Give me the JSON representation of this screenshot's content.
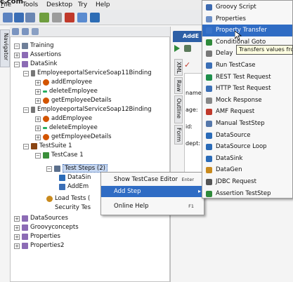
{
  "title_fragment": "c.com",
  "menubar": {
    "tools": "Tools",
    "desktop": "Desktop",
    "try": "Try",
    "help": "Help"
  },
  "navigator_tab": "Navigator",
  "tree": {
    "root": "Training",
    "items": [
      {
        "label": "Assertions"
      },
      {
        "label": "DataSink"
      },
      {
        "label": "EmployeeportalServiceSoap11Binding"
      },
      {
        "label": "addEmployee"
      },
      {
        "label": "deleteEmployee"
      },
      {
        "label": "getEmployeeDetails"
      },
      {
        "label": "EmployeeportalServiceSoap12Binding"
      },
      {
        "label": "addEmployee"
      },
      {
        "label": "deleteEmployee"
      },
      {
        "label": "getEmployeeDetails"
      },
      {
        "label": "TestSuite 1"
      },
      {
        "label": "TestCase 1"
      },
      {
        "label": "Test Steps (2)"
      },
      {
        "label": "DataSin"
      },
      {
        "label": "AddEm"
      },
      {
        "label": "Load Tests ("
      },
      {
        "label": "Security Tes"
      },
      {
        "label": "DataSources"
      },
      {
        "label": "Groovyconcepts"
      },
      {
        "label": "Properties"
      },
      {
        "label": "Properties2"
      }
    ]
  },
  "editor": {
    "tab_title": "AddE",
    "vtabs": [
      "XML",
      "Raw",
      "Outline",
      "Form"
    ],
    "fields": [
      "name",
      "age:",
      "id:",
      "dept:"
    ]
  },
  "context_menu": {
    "items": [
      {
        "label": "Show TestCase Editor",
        "shortcut": "Enter"
      },
      {
        "label": "Add Step",
        "shortcut": ""
      },
      {
        "label": "Online Help",
        "shortcut": "F1"
      }
    ]
  },
  "step_menu": {
    "items": [
      {
        "label": "Groovy Script",
        "color": "#3d6ab0"
      },
      {
        "label": "Properties",
        "color": "#6b8fc7"
      },
      {
        "label": "Property Transfer",
        "color": "#3a74c9"
      },
      {
        "label": "Conditional Goto",
        "color": "#2f8a3b"
      },
      {
        "label": "Delay",
        "color": "#777777"
      },
      {
        "label": "Run TestCase",
        "color": "#3b6fb6"
      },
      {
        "label": "REST Test Request",
        "color": "#1f8f4c"
      },
      {
        "label": "HTTP Test Request",
        "color": "#3b6fb6"
      },
      {
        "label": "Mock Response",
        "color": "#888888"
      },
      {
        "label": "AMF Request",
        "color": "#c0392b"
      },
      {
        "label": "Manual TestStep",
        "color": "#5577aa"
      },
      {
        "label": "DataSource",
        "color": "#2a6bb8"
      },
      {
        "label": "DataSource Loop",
        "color": "#2a6bb8"
      },
      {
        "label": "DataSink",
        "color": "#2a6bb8"
      },
      {
        "label": "DataGen",
        "color": "#c98a1d"
      },
      {
        "label": "JDBC Request",
        "color": "#555555"
      },
      {
        "label": "Assertion TestStep",
        "color": "#2f8a3b"
      }
    ]
  },
  "tooltip": "Transfers values from",
  "colors": {
    "highlight": "#2f6cc4",
    "selection": "#c7d8f2"
  }
}
